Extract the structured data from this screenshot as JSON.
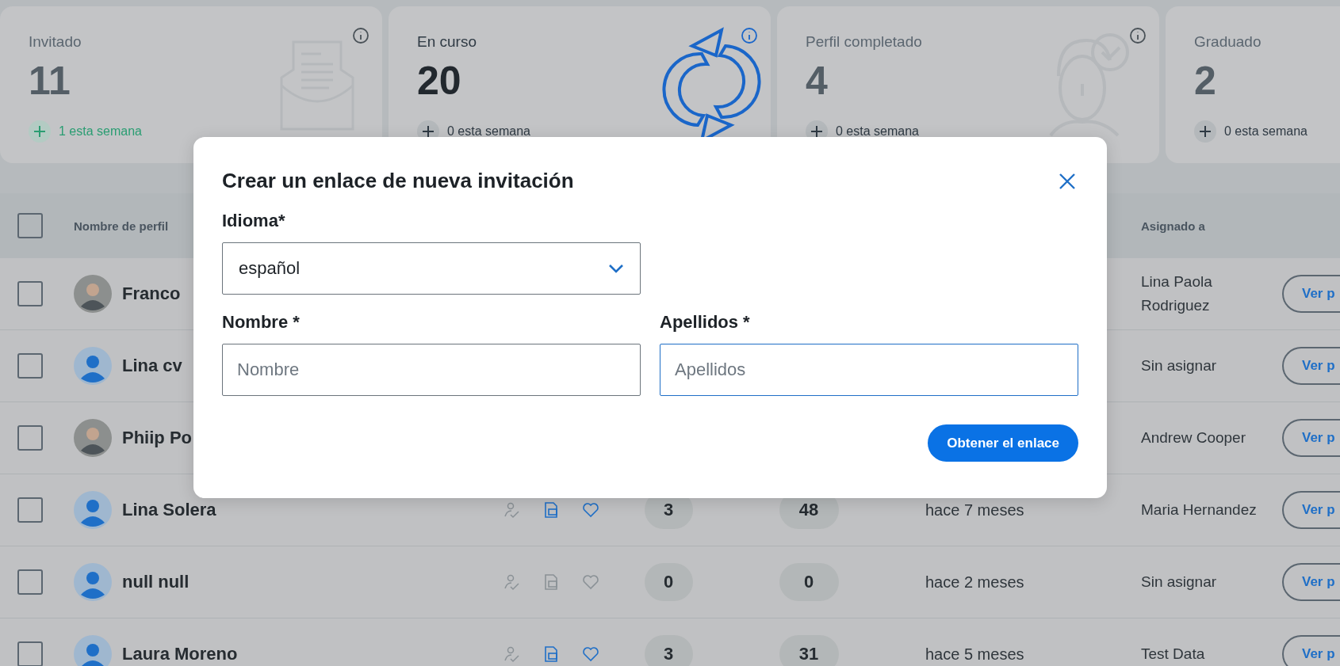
{
  "cards": [
    {
      "label": "Invitado",
      "value": "11",
      "delta": "1 esta semana",
      "positive": true,
      "highlighted": false
    },
    {
      "label": "En curso",
      "value": "20",
      "delta": "0 esta semana",
      "positive": false,
      "highlighted": true
    },
    {
      "label": "Perfil completado",
      "value": "4",
      "delta": "0 esta semana",
      "positive": false,
      "highlighted": false
    },
    {
      "label": "Graduado",
      "value": "2",
      "delta": "0 esta semana",
      "positive": false,
      "highlighted": false
    }
  ],
  "table": {
    "all_selected": false,
    "columns": {
      "name": "Nombre de perfil",
      "assigned": "Asignado a"
    },
    "rows": [
      {
        "name": "Franco",
        "photo": true,
        "checked": false,
        "assigned": "Lina Paola Rodriguez",
        "action": "Ver p"
      },
      {
        "name": "Lina cv",
        "photo": false,
        "checked": false,
        "assigned": "Sin asignar",
        "action": "Ver p"
      },
      {
        "name": "Phiip Po",
        "photo": true,
        "checked": false,
        "assigned": "Andrew Cooper",
        "action": "Ver p"
      },
      {
        "name": "Lina Solera",
        "photo": false,
        "checked": false,
        "cv": true,
        "favorite": true,
        "count_1": "3",
        "count_2": "48",
        "time": "hace 7 meses",
        "assigned": "Maria Hernandez",
        "action": "Ver p"
      },
      {
        "name": "null null",
        "photo": false,
        "checked": false,
        "cv": false,
        "favorite": false,
        "count_1": "0",
        "count_2": "0",
        "time": "hace 2 meses",
        "assigned": "Sin asignar",
        "action": "Ver p"
      },
      {
        "name": "Laura Moreno",
        "photo": false,
        "checked": false,
        "cv": true,
        "favorite": true,
        "count_1": "3",
        "count_2": "31",
        "time": "hace 5 meses",
        "assigned": "Test Data",
        "action": "Ver p"
      }
    ]
  },
  "dialog": {
    "title": "Crear un enlace de nueva invitación",
    "language": {
      "label": "Idioma*",
      "value": "español"
    },
    "first_name": {
      "label": "Nombre *",
      "placeholder": "Nombre",
      "focused": false
    },
    "last_name": {
      "label": "Apellidos *",
      "placeholder": "Apellidos",
      "focused": true
    },
    "submit": "Obtener el enlace"
  }
}
